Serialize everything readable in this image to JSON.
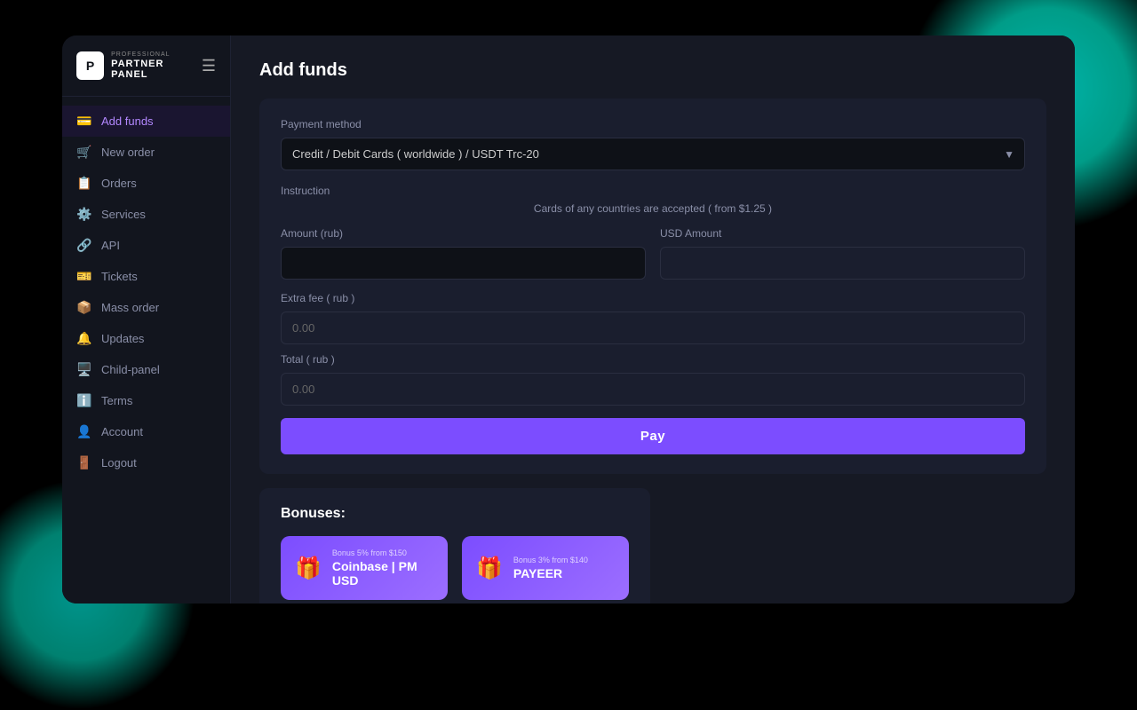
{
  "app": {
    "logo_small": "PROFESSIONAL",
    "logo_big": "PARTNER PANEL",
    "logo_initial": "P"
  },
  "sidebar": {
    "items": [
      {
        "key": "add-funds",
        "label": "Add funds",
        "icon": "💳",
        "active": true
      },
      {
        "key": "new-order",
        "label": "New order",
        "icon": "🛒",
        "active": false
      },
      {
        "key": "orders",
        "label": "Orders",
        "icon": "📋",
        "active": false
      },
      {
        "key": "services",
        "label": "Services",
        "icon": "⚙️",
        "active": false
      },
      {
        "key": "api",
        "label": "API",
        "icon": "🔗",
        "active": false
      },
      {
        "key": "tickets",
        "label": "Tickets",
        "icon": "🎫",
        "active": false
      },
      {
        "key": "mass-order",
        "label": "Mass order",
        "icon": "📦",
        "active": false
      },
      {
        "key": "updates",
        "label": "Updates",
        "icon": "🔔",
        "active": false
      },
      {
        "key": "child-panel",
        "label": "Child-panel",
        "icon": "🖥️",
        "active": false
      },
      {
        "key": "terms",
        "label": "Terms",
        "icon": "ℹ️",
        "active": false
      },
      {
        "key": "account",
        "label": "Account",
        "icon": "👤",
        "active": false
      },
      {
        "key": "logout",
        "label": "Logout",
        "icon": "🚪",
        "active": false
      }
    ]
  },
  "page": {
    "title": "Add funds"
  },
  "payment_method": {
    "label": "Payment method",
    "selected": "Credit / Debit Cards ( worldwide ) / USDT Trc-20",
    "options": [
      "Credit / Debit Cards ( worldwide ) / USDT Trc-20"
    ]
  },
  "instruction": {
    "label": "Instruction",
    "text": "Cards of any countries are accepted ( from $1.25 )"
  },
  "amount": {
    "label": "Amount (rub)",
    "value": "",
    "placeholder": ""
  },
  "usd_amount": {
    "label": "USD Amount",
    "value": "",
    "placeholder": ""
  },
  "extra_fee": {
    "label": "Extra fee ( rub )",
    "value": "0.00"
  },
  "total": {
    "label": "Total ( rub )",
    "value": "0.00"
  },
  "pay_button": {
    "label": "Pay"
  },
  "bonuses": {
    "title": "Bonuses:",
    "items": [
      {
        "name": "Coinbase | PM USD",
        "small_text": "Bonus 5% from $150",
        "icon": "🎁"
      },
      {
        "name": "PAYEER",
        "small_text": "Bonus 3% from $140",
        "icon": "🎁"
      }
    ]
  }
}
